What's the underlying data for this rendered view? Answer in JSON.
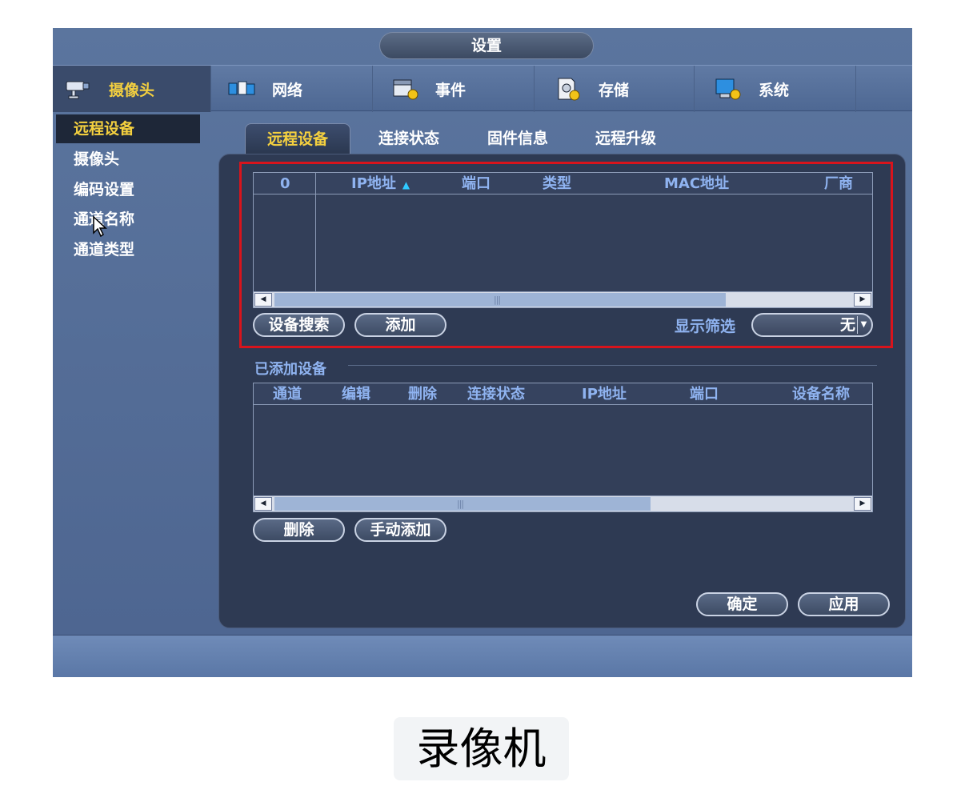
{
  "window": {
    "title": "设置"
  },
  "nav": {
    "items": [
      {
        "label": "摄像头",
        "icon": "camera-icon",
        "active": true
      },
      {
        "label": "网络",
        "icon": "network-icon",
        "active": false
      },
      {
        "label": "事件",
        "icon": "event-icon",
        "active": false
      },
      {
        "label": "存储",
        "icon": "storage-icon",
        "active": false
      },
      {
        "label": "系统",
        "icon": "system-icon",
        "active": false
      }
    ]
  },
  "left_menu": {
    "items": [
      {
        "label": "远程设备",
        "active": true
      },
      {
        "label": "摄像头",
        "active": false
      },
      {
        "label": "编码设置",
        "active": false
      },
      {
        "label": "通道名称",
        "active": false
      },
      {
        "label": "通道类型",
        "active": false
      }
    ]
  },
  "tabs": [
    {
      "label": "远程设备",
      "active": true
    },
    {
      "label": "连接状态",
      "active": false
    },
    {
      "label": "固件信息",
      "active": false
    },
    {
      "label": "远程升级",
      "active": false
    }
  ],
  "search_table": {
    "columns": [
      "0",
      "IP地址",
      "端口",
      "类型",
      "MAC地址",
      "厂商"
    ],
    "sort_indicator": "▲",
    "rows": []
  },
  "search_actions": {
    "search_button": "设备搜索",
    "add_button": "添加",
    "filter_label": "显示筛选",
    "filter_value": "无"
  },
  "added_section": {
    "title": "已添加设备",
    "columns": [
      "通道",
      "编辑",
      "删除",
      "连接状态",
      "IP地址",
      "端口",
      "设备名称"
    ],
    "rows": []
  },
  "added_actions": {
    "delete_button": "删除",
    "manual_add_button": "手动添加"
  },
  "footer": {
    "ok_button": "确定",
    "apply_button": "应用"
  },
  "caption": "录像机",
  "colors": {
    "highlight_box": "#d8141c",
    "active_text": "#f4d03f",
    "header_text": "#8fb3f0"
  }
}
